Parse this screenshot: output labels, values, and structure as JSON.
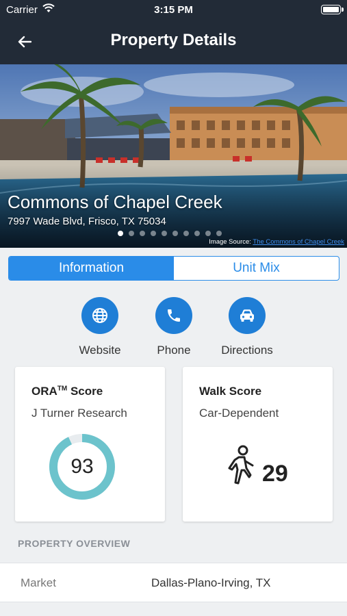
{
  "status_bar": {
    "carrier": "Carrier",
    "time": "3:15 PM"
  },
  "nav": {
    "title": "Property Details"
  },
  "hero": {
    "name": "Commons of Chapel Creek",
    "address": "7997 Wade Blvd, Frisco, TX 75034",
    "image_source_label": "Image Source:",
    "image_source_link": "The Commons of Chapel Creek",
    "page_count": 10,
    "active_page": 1
  },
  "tabs": [
    {
      "label": "Information",
      "active": true
    },
    {
      "label": "Unit Mix",
      "active": false
    }
  ],
  "actions": [
    {
      "label": "Website",
      "icon": "globe-icon"
    },
    {
      "label": "Phone",
      "icon": "phone-icon"
    },
    {
      "label": "Directions",
      "icon": "car-icon"
    }
  ],
  "ora_card": {
    "title": "ORA",
    "title_sup": "TM",
    "title_suffix": "Score",
    "subtitle": "J Turner Research",
    "score": "93",
    "score_fraction": 0.93
  },
  "walk_card": {
    "title": "Walk Score",
    "subtitle": "Car-Dependent",
    "score": "29",
    "icon": "walking-person-icon"
  },
  "overview": {
    "heading": "PROPERTY OVERVIEW",
    "rows": [
      {
        "key": "Market",
        "value": "Dallas-Plano-Irving, TX"
      }
    ]
  },
  "colors": {
    "header_bg": "#222b37",
    "accent": "#2a8ce8",
    "action_circle": "#1f7ed6",
    "donut_fill": "#6cc3cc",
    "donut_track": "#e8ecef"
  }
}
